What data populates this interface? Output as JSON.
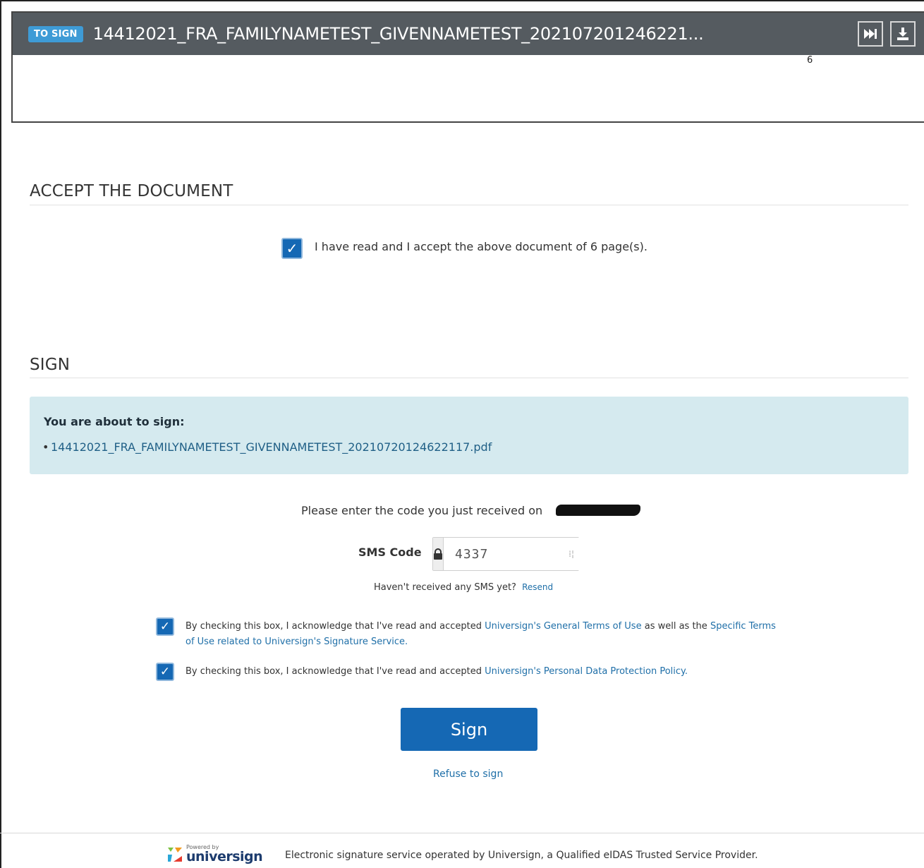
{
  "viewer": {
    "badge": "TO SIGN",
    "title": "14412021_FRA_FAMILYNAMETEST_GIVENNAMETEST_202107201246221...",
    "page_number": "6",
    "next_icon": "skip-forward-icon",
    "download_icon": "download-icon"
  },
  "accept": {
    "heading": "ACCEPT THE DOCUMENT",
    "checkbox_checked": true,
    "label": "I have read and I accept the above document of 6 page(s)."
  },
  "sign": {
    "heading": "SIGN",
    "info_title": "You are about to sign:",
    "file_name": "14412021_FRA_FAMILYNAMETEST_GIVENNAMETEST_20210720124622117.pdf",
    "code_prompt": "Please enter the code you just received on",
    "sms_label": "SMS Code",
    "sms_value": "4337",
    "no_sms_text": "Haven't received any SMS yet?",
    "resend_label": "Resend",
    "terms1_prefix": "By checking this box, I acknowledge that I've read and accepted ",
    "terms1_link1": "Universign's General Terms of Use",
    "terms1_middle": " as well as the ",
    "terms1_link2": "Specific Terms of Use related to Universign's Signature Service.",
    "terms2_prefix": "By checking this box, I acknowledge that I've read and accepted ",
    "terms2_link": "Universign's Personal Data Protection Policy.",
    "sign_button": "Sign",
    "refuse_link": "Refuse to sign"
  },
  "footer": {
    "powered_by": "Powered by",
    "brand": "universign",
    "text": "Electronic signature service operated by Universign, a Qualified eIDAS Trusted Service Provider."
  },
  "colors": {
    "primary": "#1568b4",
    "header_bg": "#555b60",
    "badge_bg": "#3e9bd6",
    "info_bg": "#d5eaef",
    "link": "#1f6fa8"
  }
}
